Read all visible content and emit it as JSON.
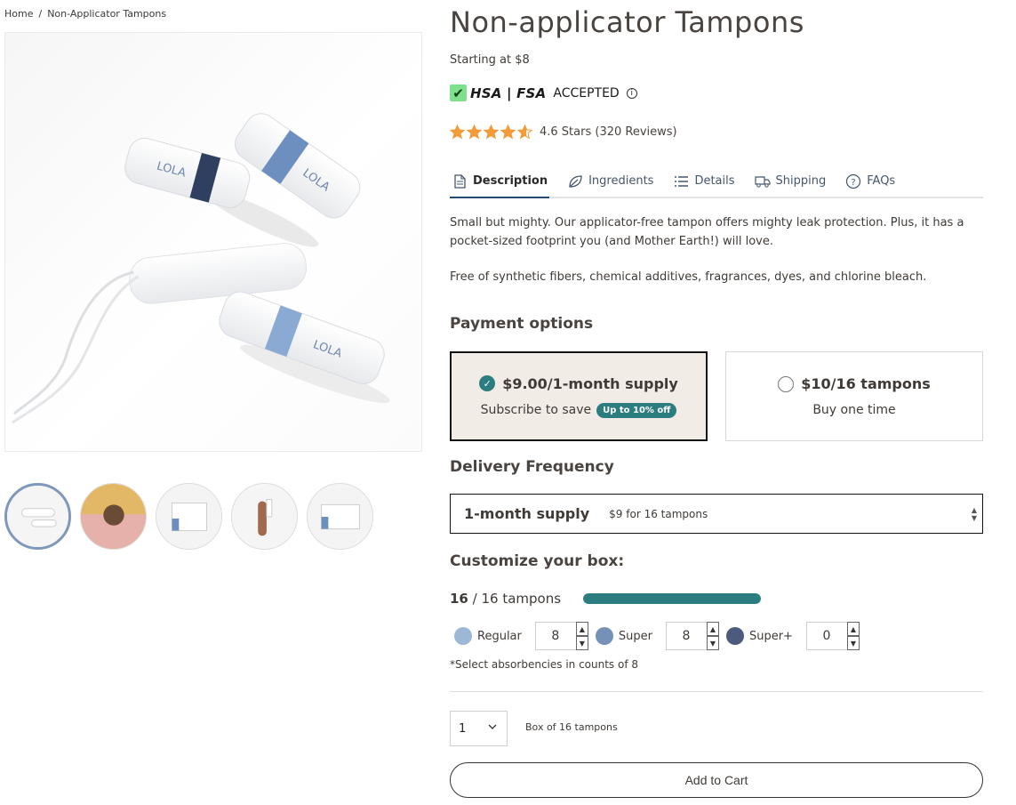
{
  "breadcrumb": {
    "home": "Home",
    "sep": "/",
    "current": "Non-Applicator Tampons"
  },
  "product": {
    "title": "Non-applicator Tampons",
    "starting_price": "Starting at $8",
    "hsa_check": "✔",
    "hsa_brand": "HSA | FSA",
    "hsa_status": "ACCEPTED",
    "rating_text": "4.6 Stars (320 Reviews)",
    "rating_value": 4.6,
    "star_color": "#f29b38"
  },
  "tabs": [
    {
      "label": "Description",
      "icon": "document-icon",
      "active": true
    },
    {
      "label": "Ingredients",
      "icon": "leaf-icon",
      "active": false
    },
    {
      "label": "Details",
      "icon": "list-icon",
      "active": false
    },
    {
      "label": "Shipping",
      "icon": "truck-icon",
      "active": false
    },
    {
      "label": "FAQs",
      "icon": "question-circle-icon",
      "active": false
    }
  ],
  "description": {
    "p1": "Small but mighty. Our applicator-free tampon offers mighty leak protection. Plus, it has a pocket-sized footprint you (and Mother Earth!) will love.",
    "p2": "Free of synthetic fibers, chemical additives, fragrances, dyes, and chlorine bleach."
  },
  "payment": {
    "heading": "Payment options",
    "subscribe": {
      "price": "$9.00/1-month supply",
      "sub": "Subscribe to save",
      "badge": "Up to 10% off",
      "selected": true
    },
    "once": {
      "price": "$10/16 tampons",
      "sub": "Buy one time",
      "selected": false
    }
  },
  "delivery": {
    "heading": "Delivery Frequency",
    "selected": "1-month supply",
    "detail": "$9 for 16 tampons"
  },
  "customize": {
    "heading": "Customize your box:",
    "count": "16",
    "total": "/ 16 tampons",
    "progress": 1.0,
    "accent": "#2b7d7f",
    "absorbencies": [
      {
        "label": "Regular",
        "value": "8",
        "color": "#9db7d6"
      },
      {
        "label": "Super",
        "value": "8",
        "color": "#7691b8"
      },
      {
        "label": "Super+",
        "value": "0",
        "color": "#4c5a7d"
      }
    ],
    "note": "*Select absorbencies in counts of 8"
  },
  "purchase": {
    "qty": "1",
    "box_text": "Box of 16 tampons",
    "cart_label": "Add to Cart"
  }
}
